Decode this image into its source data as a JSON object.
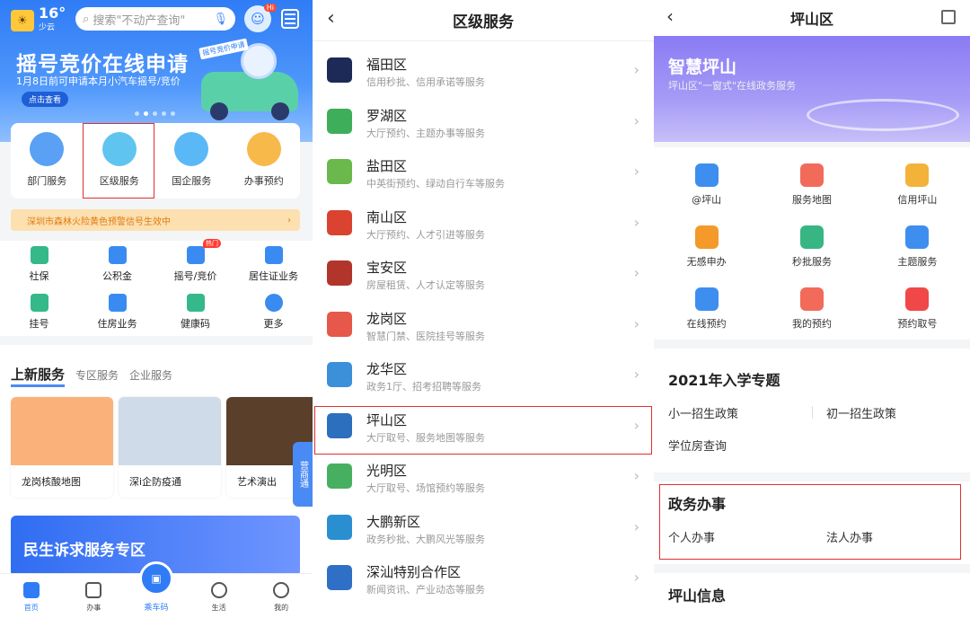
{
  "panel1": {
    "weather": {
      "temp": "16°",
      "cond": "少云"
    },
    "search_placeholder": "搜索\"不动产查询\"",
    "robot_badge": "Hi",
    "banner": {
      "title": "摇号竞价在线申请",
      "subtitle": "1月8日前可申请本月小汽车摇号/竞价",
      "button": "点击查看",
      "tag": "摇号竞价申请"
    },
    "quick": [
      {
        "label": "部门服务",
        "color": "#5aa0f5"
      },
      {
        "label": "区级服务",
        "color": "#5fc4f0"
      },
      {
        "label": "国企服务",
        "color": "#5bb8f7"
      },
      {
        "label": "办事预约",
        "color": "#f6b94a"
      }
    ],
    "warning": "深圳市森林火险黄色预警信号生效中",
    "grid": [
      {
        "label": "社保",
        "color": "#35b88a"
      },
      {
        "label": "公积金",
        "color": "#3a8bf1"
      },
      {
        "label": "摇号/竞价",
        "color": "#3a8bf1"
      },
      {
        "label": "居住证业务",
        "color": "#3a8bf1"
      },
      {
        "label": "挂号",
        "color": "#35b88a"
      },
      {
        "label": "住房业务",
        "color": "#3a8bf1"
      },
      {
        "label": "健康码",
        "color": "#35b88a"
      },
      {
        "label": "更多",
        "color": "#3a8bf1"
      }
    ],
    "hot_badge": "热门",
    "tabs": [
      "上新服务",
      "专区服务",
      "企业服务"
    ],
    "news": [
      {
        "caption": "龙岗核酸地图",
        "color": "#fbb27a"
      },
      {
        "caption": "深i企防疫通",
        "color": "#cfdbe8"
      },
      {
        "caption": "艺术演出",
        "color": "#5a3f2a"
      }
    ],
    "side_tab": "营商通",
    "big_banner": "民生诉求服务专区",
    "tabbar": [
      "首页",
      "办事",
      "乘车码",
      "生活",
      "我的"
    ]
  },
  "panel2": {
    "title": "区级服务",
    "districts": [
      {
        "name": "福田区",
        "desc": "信用秒批、信用承诺等服务",
        "color": "#1d2a56"
      },
      {
        "name": "罗湖区",
        "desc": "大厅预约、主题办事等服务",
        "color": "#3fae5a"
      },
      {
        "name": "盐田区",
        "desc": "中英街预约、绿动自行车等服务",
        "color": "#6bb84c"
      },
      {
        "name": "南山区",
        "desc": "大厅预约、人才引进等服务",
        "color": "#d9432f"
      },
      {
        "name": "宝安区",
        "desc": "房屋租赁、人才认定等服务",
        "color": "#b2352c"
      },
      {
        "name": "龙岗区",
        "desc": "智慧门禁、医院挂号等服务",
        "color": "#e6584a"
      },
      {
        "name": "龙华区",
        "desc": "政务1厅、招考招聘等服务",
        "color": "#3c8fd9"
      },
      {
        "name": "坪山区",
        "desc": "大厅取号、服务地图等服务",
        "color": "#2c6fbf"
      },
      {
        "name": "光明区",
        "desc": "大厅取号、场馆预约等服务",
        "color": "#46b060"
      },
      {
        "name": "大鹏新区",
        "desc": "政务秒批、大鹏风光等服务",
        "color": "#2a8fd0"
      },
      {
        "name": "深汕特别合作区",
        "desc": "新闻资讯、产业动态等服务",
        "color": "#2f6fc5"
      }
    ]
  },
  "panel3": {
    "title": "坪山区",
    "hero": {
      "title": "智慧坪山",
      "subtitle": "坪山区\"一窗式\"在线政务服务"
    },
    "services": [
      {
        "label": "@坪山",
        "color": "#3e8ef0"
      },
      {
        "label": "服务地图",
        "color": "#f26a5a"
      },
      {
        "label": "信用坪山",
        "color": "#f3b23a"
      },
      {
        "label": "无感申办",
        "color": "#f39a2b"
      },
      {
        "label": "秒批服务",
        "color": "#37b683"
      },
      {
        "label": "主题服务",
        "color": "#3e8ef0"
      },
      {
        "label": "在线预约",
        "color": "#3e8ef0"
      },
      {
        "label": "我的预约",
        "color": "#f26a5a"
      },
      {
        "label": "预约取号",
        "color": "#f04848"
      }
    ],
    "enroll": {
      "title": "2021年入学专题",
      "links": [
        "小一招生政策",
        "初一招生政策",
        "学位房查询"
      ]
    },
    "affairs": {
      "title": "政务办事",
      "links": [
        "个人办事",
        "法人办事"
      ]
    },
    "info_title": "坪山信息"
  }
}
